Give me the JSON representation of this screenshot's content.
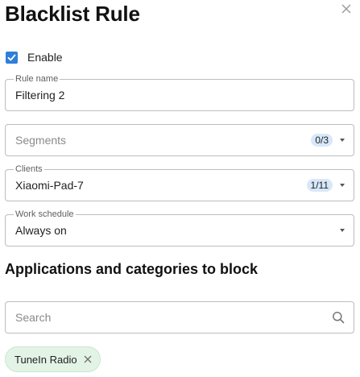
{
  "dialog": {
    "title": "Blacklist Rule"
  },
  "enable": {
    "label": "Enable",
    "checked": true
  },
  "rule_name": {
    "legend": "Rule name",
    "value": "Filtering 2"
  },
  "segments": {
    "placeholder": "Segments",
    "count": "0/3"
  },
  "clients": {
    "legend": "Clients",
    "value": "Xiaomi-Pad-7",
    "count": "1/11"
  },
  "work_schedule": {
    "legend": "Work schedule",
    "value": "Always on"
  },
  "apps_section": {
    "heading": "Applications and categories to block",
    "search_placeholder": "Search",
    "chips": [
      {
        "label": "TuneIn Radio"
      }
    ]
  },
  "colors": {
    "accent": "#2f7fd8",
    "badge": "#d7e8fa",
    "chip": "#e3f4e7"
  },
  "icons": [
    "close-icon",
    "checkmark-icon",
    "chevron-down-icon",
    "search-icon",
    "chip-remove-icon"
  ]
}
